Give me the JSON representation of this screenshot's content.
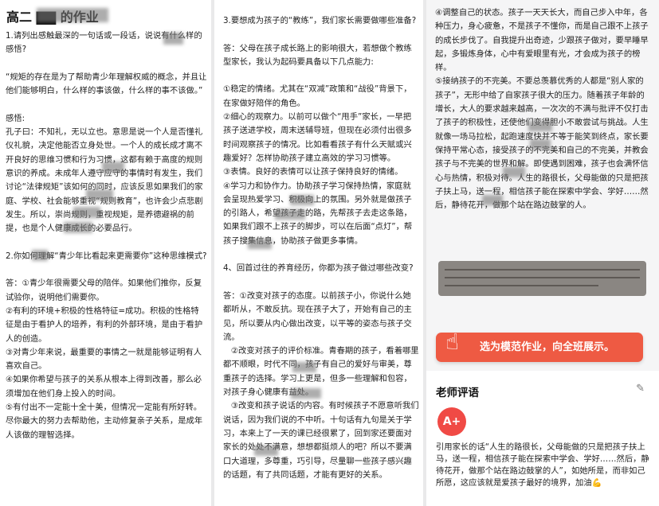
{
  "column1": {
    "title": "高二 ▇▇ 的作业",
    "body": "1.请列出感触最深的一句话或一段话，说说有什么样的感悟?\n\n“规矩的存在是为了帮助青少年理解权威的概念，并且让他们能够明白，什么样的事该做，什么样的事不该做。”\n\n感悟:\n孔子曰：不知礼，无以立也。意思是说一个人是否懂礼仪礼貌，决定他能否立身处世。一个人的成长成才离不开良好的思维习惯和行为习惯，这都有赖于高度的规则意识的养成。未成年人遵守应守的事情时有发生，我们讨论“法律规矩”该如何的同时，应该反思如果我们的家庭、学校、社会能够重视“规则教育”，也许会少点悲剧发生。所以，崇尚规则，重视规矩，是养德避祸的前提，也是个人健康成长的必要品行。\n\n2.你如何理解“青少年比看起来更需要你”这种思维模式?\n\n答：①青少年很需要父母的陪伴。如果他们推你，反复试验你，说明他们需要你。\n②有利的环境+积极的性格特征=成功。积极的性格特征是由于看护人的培养，有利的外部环境，是由于看护人的创造。\n③对青少年来说，最重要的事情之一就是能够证明有人喜欢自己。\n④如果你希望与孩子的关系从根本上得到改善，那么必须增加在他们身上投入的时间。\n⑤有付出不一定能十全十美，但情况一定能有所好转。尽你最大的努力去帮助他，主动修复亲子关系，是成年人该做的理智选择。"
  },
  "column2": {
    "body": "3.要想成为孩子的“教练”，我们家长需要做哪些准备?\n\n答：父母在孩子成长路上的影响很大，若想做个教练型家长，我认为起码要具备以下几点能力:\n\n①稳定的情绪。尤其在“双减”政策和“战役”背景下，在家做好陪伴的角色。\n②细心的观察力。以前可以做个“甩手”家长，一早把孩子送进学校，周末送辅导班，但现在必须付出很多时间观察孩子的情况。比如看看孩子有什么天赋或兴趣爱好？怎样协助孩子建立高效的学习习惯等。\n③表情。良好的表情可以让孩子保持良好的情绪。\n④学习力和协作力。协助孩子学习保持热情，家庭就会呈现热爱学习、积极向上的氛围。另外就是做孩子的引路人，希望孩子走的路，先帮孩子去走这条路，如果我们跟不上孩子的脚步，可以在后面“点灯”，帮孩子搜集信息，协助孩子做更多事情。\n\n4、回首过往的养育经历，你都为孩子做过哪些改变?\n\n答：①改变对孩子的态度。以前孩子小，你说什么她都听从，不敢反抗。现在孩子大了，开始有自己的主见，所以要从内心做出改变，以平等的姿态与孩子交流。\n   ②改变对孩子的评价标准。青春期的孩子，看着哪里都不顺眼，时代不同，孩子有自己的爱好与审美，尊重孩子的选择。学习上更是，但多一些理解和包容，对孩子身心健康有益处。\n   ③改变和孩子说话的内容。有时候孩子不愿意听我们说话，因为我们说的不中听。十句话有九句是关于学习，本来上了一天的课已经很累了，回到家还要面对家长的处处不满意，想想都挺烦人的吧？所以不要满口大道理，多尊重，巧引导，尽量聊一些孩子感兴趣的话题，有了共同话题，才能有更好的关系。"
  },
  "column3": {
    "body": "④调整自己的状态。孩子一天天长大，而自己步入中年，各种压力，身心疲惫，不是孩子不懂你，而是自己跟不上孩子的成长步伐了。自我提升出奇迹，少跟孩子做对，要早睡早起，多锻炼身体，心中有爱眼里有光，才会成为孩子的榜样。\n⑤接纳孩子的不完美。不要总羡慕优秀的人都是“别人家的孩子”，无形中给了自家孩子很大的压力。随着孩子年龄的增长，大人的要求越来越高，一次次的不满与批评不仅打击了孩子的积极性，还使他们变得胆小不敢尝试与挑战。人生就像一场马拉松，起跑速度快并不等于能笑到终点，家长要保持平常心态，接受孩子的不完美和自己的不完美，并教会孩子与不完美的世界和解。即使遇到困难，孩子也会满怀信心与热情，积极对待。人生的路很长，父母能做的只是把孩子扶上马，送一程，相信孩子能在探索中学会、学好……然后，静待花开，做那个站在路边鼓掌的人。",
    "photo_caption": "规矩的存在是为了帮助青少年理解权威的概念，并且让他们能够明白，什么样的事该做，什么样的事不该做。",
    "cta_label": "选为模范作业，向全班展示。",
    "cta_icon": "pointing-hand-icon"
  },
  "teacher": {
    "section_title": "老师评语",
    "edit_icon": "pencil-icon",
    "grade": "A+",
    "comment": "引用家长的话“人生的路很长，父母能做的只是把孩子扶上马，送一程，相信孩子能在探索中学会、学好……然后，静待花开，做那个站在路边鼓掌的人”，如她所是，而非如己所愿，这应该就是爱孩子最好的境界，加油💪"
  },
  "colors": {
    "cta_background": "#ee5a43",
    "avatar_background": "#f04a45"
  }
}
